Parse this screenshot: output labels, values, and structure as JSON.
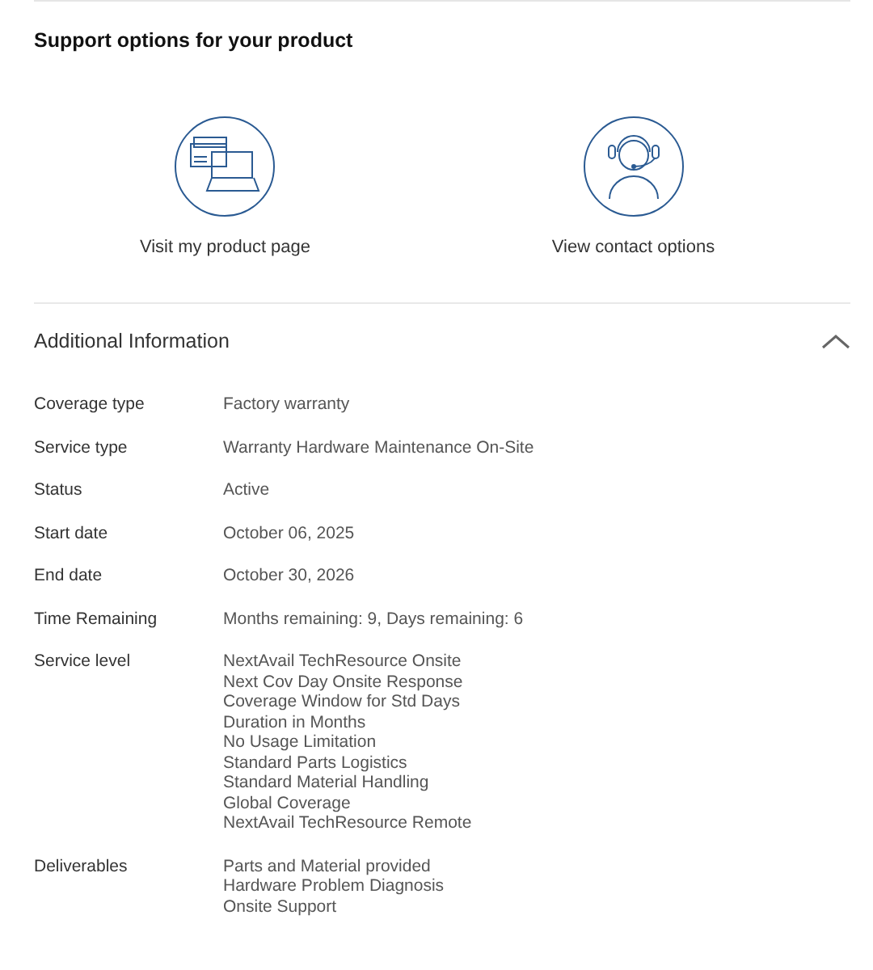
{
  "support": {
    "title": "Support options for your product",
    "options": [
      {
        "kind": "product",
        "label": "Visit my product page"
      },
      {
        "kind": "contact",
        "label": "View contact options"
      }
    ]
  },
  "additional_info": {
    "title": "Additional Information",
    "expanded": true,
    "rows": [
      {
        "label": "Coverage type",
        "values": [
          "Factory warranty"
        ]
      },
      {
        "label": "Service type",
        "values": [
          "Warranty Hardware Maintenance On-Site"
        ]
      },
      {
        "label": "Status",
        "values": [
          "Active"
        ]
      },
      {
        "label": "Start date",
        "values": [
          "October 06, 2025"
        ]
      },
      {
        "label": "End date",
        "values": [
          "October 30, 2026"
        ]
      },
      {
        "label": "Time Remaining",
        "values": [
          "Months remaining: 9, Days remaining: 6"
        ]
      },
      {
        "label": "Service level",
        "values": [
          "NextAvail TechResource Onsite",
          "Next Cov Day Onsite Response",
          "Coverage Window for Std Days",
          "Duration in Months",
          "No Usage Limitation",
          "Standard Parts Logistics",
          "Standard Material Handling",
          "Global Coverage",
          "NextAvail TechResource Remote"
        ]
      },
      {
        "label": "Deliverables",
        "values": [
          "Parts and Material provided",
          "Hardware Problem Diagnosis",
          "Onsite Support"
        ]
      }
    ]
  }
}
